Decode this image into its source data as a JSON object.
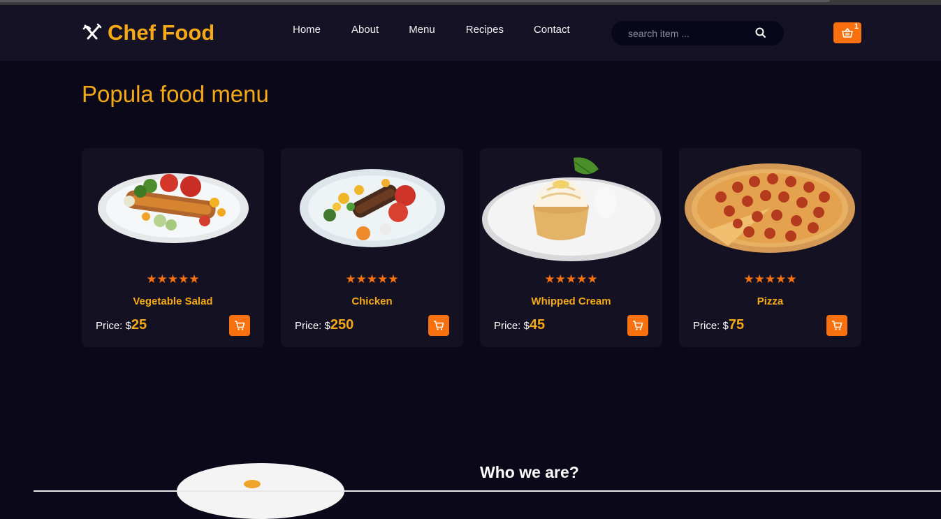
{
  "app": {
    "brand": "Chef Food",
    "logo_icon": "fork-knife-icon",
    "accent": "#f5a916",
    "orange": "#f9710f"
  },
  "nav": {
    "items": [
      {
        "label": "Home"
      },
      {
        "label": "About"
      },
      {
        "label": "Menu"
      },
      {
        "label": "Recipes"
      },
      {
        "label": "Contact"
      }
    ]
  },
  "search": {
    "placeholder": "search item ...",
    "icon": "search-icon"
  },
  "cart": {
    "icon": "basket-icon",
    "count": "1"
  },
  "menu_section": {
    "title": "Popula food menu",
    "price_label": "Price: $",
    "stars": "★★★★★",
    "rating": 5,
    "items": [
      {
        "name": "Vegetable Salad",
        "price": "25",
        "image": "vegetable-salad-plate"
      },
      {
        "name": "Chicken",
        "price": "250",
        "image": "grilled-chicken-plate"
      },
      {
        "name": "Whipped Cream",
        "price": "45",
        "image": "whipped-cream-tart"
      },
      {
        "name": "Pizza",
        "price": "75",
        "image": "pepperoni-pizza"
      }
    ]
  },
  "about_section": {
    "heading": "Who we are?"
  }
}
